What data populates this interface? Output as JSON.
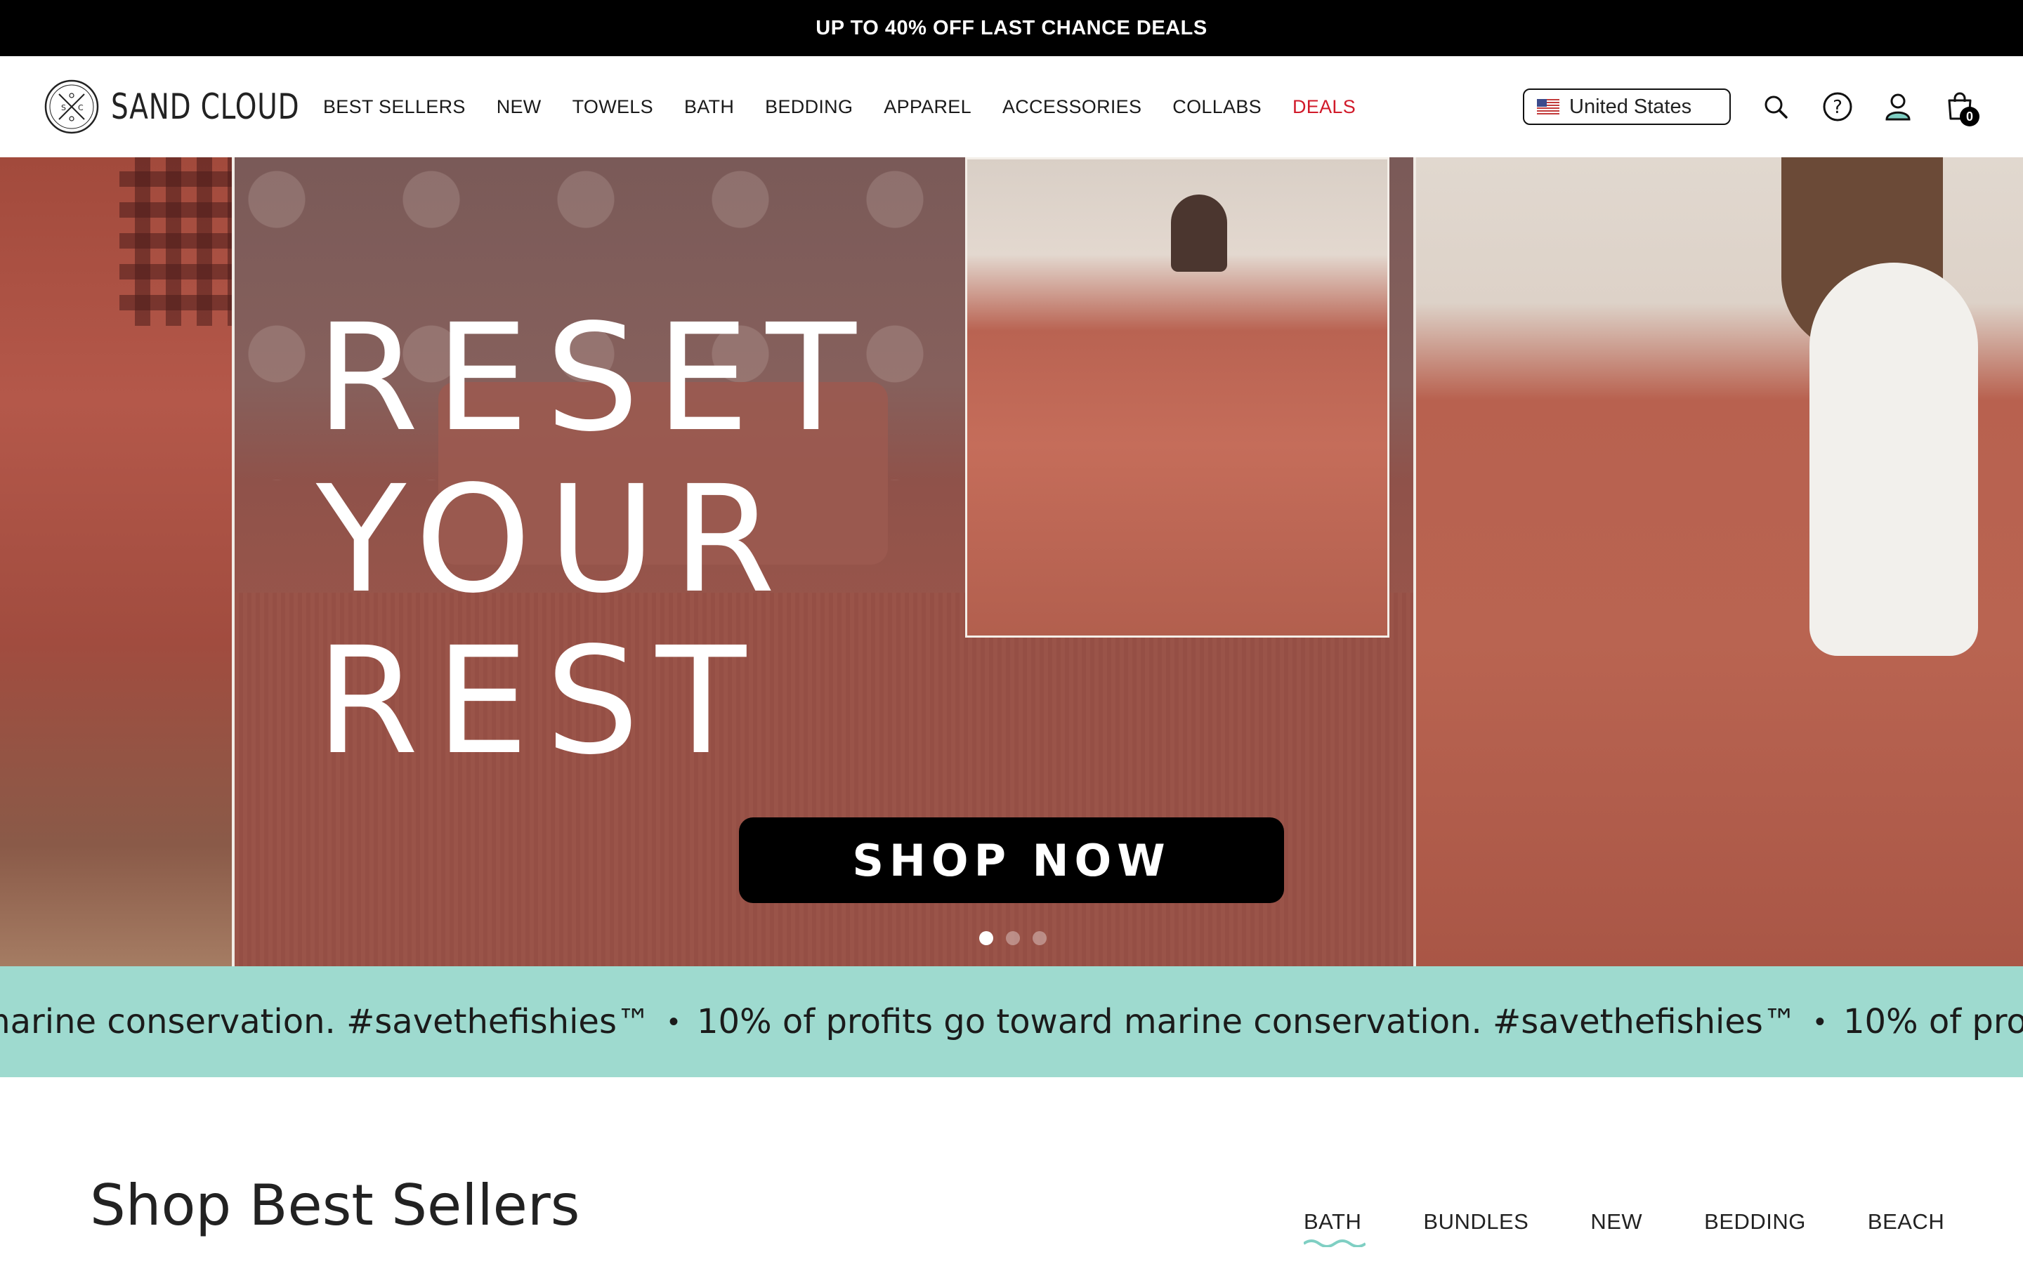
{
  "promo": {
    "text": "UP TO 40% OFF LAST CHANCE DEALS"
  },
  "header": {
    "logo_text": "SAND CLOUD",
    "nav": [
      {
        "label": "BEST SELLERS"
      },
      {
        "label": "NEW"
      },
      {
        "label": "TOWELS"
      },
      {
        "label": "BATH"
      },
      {
        "label": "BEDDING"
      },
      {
        "label": "APPAREL"
      },
      {
        "label": "ACCESSORIES"
      },
      {
        "label": "COLLABS"
      },
      {
        "label": "DEALS"
      }
    ],
    "country": "United States",
    "cart_count": "0",
    "icons": [
      "search-icon",
      "help-icon",
      "account-icon",
      "cart-icon"
    ]
  },
  "hero": {
    "title": "RESET\nYOUR\nREST",
    "cta": "SHOP NOW",
    "slides_total": 3,
    "active_slide": 1
  },
  "marquee": {
    "text": "10% of profits go toward marine conservation. #savethefishies™",
    "separator": "•"
  },
  "best_sellers": {
    "title": "Shop Best Sellers",
    "tabs": [
      {
        "label": "BATH"
      },
      {
        "label": "BUNDLES"
      },
      {
        "label": "NEW"
      },
      {
        "label": "BEDDING"
      },
      {
        "label": "BEACH"
      }
    ],
    "active_tab": "BATH"
  },
  "colors": {
    "promo_bg": "#000000",
    "deals": "#d11a2a",
    "marquee_bg": "#9edacf",
    "accent_wave": "#7fcfc3"
  }
}
